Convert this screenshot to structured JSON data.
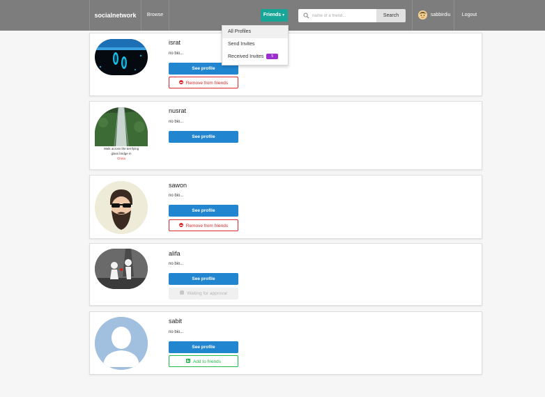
{
  "nav": {
    "brand": "socialnetwork",
    "browse": "Browse",
    "friends": "Friends",
    "search_placeholder": "name of a friend...",
    "search_button": "Search",
    "username": "sabbirdiu",
    "logout": "Logout"
  },
  "dropdown": {
    "items": [
      {
        "label": "All Profiles"
      },
      {
        "label": "Send Invites"
      },
      {
        "label": "Received Invites",
        "badge": "5"
      }
    ]
  },
  "profiles": [
    {
      "name": "israt",
      "bio": "no bio...",
      "primary": "See profile",
      "secondary": "Remove from friends"
    },
    {
      "name": "nusrat",
      "bio": "no bio...",
      "primary": "See profile",
      "caption_lines": [
        "Walk across the terrifying",
        "glass bridge in"
      ],
      "caption_place": "China"
    },
    {
      "name": "sawon",
      "bio": "no bio...",
      "primary": "See profile",
      "secondary": "Remove from friends"
    },
    {
      "name": "alifa",
      "bio": "no bio...",
      "primary": "See profile",
      "secondary": "Waiting for approval"
    },
    {
      "name": "sabit",
      "bio": "no bio...",
      "primary": "See profile",
      "secondary": "Add to friends"
    }
  ],
  "colors": {
    "navbar": "#7d7d7d",
    "friends_button": "#16a596",
    "primary_button": "#2185d0",
    "remove": "#db2828",
    "add": "#21ba45",
    "badge": "#9c2ecf"
  }
}
